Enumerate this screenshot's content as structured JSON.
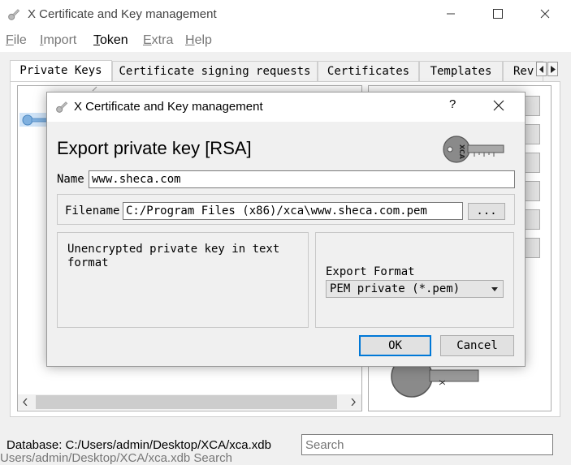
{
  "window": {
    "title": "X Certificate and Key management"
  },
  "menu": {
    "items": [
      {
        "label": "File",
        "underline": "F",
        "rest": "ile"
      },
      {
        "label": "Import",
        "underline": "I",
        "rest": "mport"
      },
      {
        "label": "Token",
        "underline": "T",
        "rest": "oken"
      },
      {
        "label": "Extra",
        "underline": "E",
        "rest": "xtra"
      },
      {
        "label": "Help",
        "underline": "H",
        "rest": "elp"
      }
    ]
  },
  "tabs": [
    {
      "label": "Private Keys",
      "active": true
    },
    {
      "label": "Certificate signing requests",
      "active": false
    },
    {
      "label": "Certificates",
      "active": false
    },
    {
      "label": "Templates",
      "active": false
    },
    {
      "label": "Rev",
      "active": false
    }
  ],
  "statusbar": {
    "database_label": "Database: C:/Users/admin/Desktop/XCA/xca.xdb",
    "search_placeholder": "Search",
    "ghost_text": "Users/admin/Desktop/XCA/xca.xdb   Search"
  },
  "dialog": {
    "title": "X Certificate and Key management",
    "help": "?",
    "heading": "Export private key [RSA]",
    "name_label": "Name",
    "name_value": "www.sheca.com",
    "filename_label": "Filename",
    "filename_value": "C:/Program Files (x86)/xca\\www.sheca.com.pem",
    "browse_label": "...",
    "description": "Unencrypted private key in text format",
    "format_label": "Export Format",
    "format_value": "PEM private (*.pem)",
    "ok_label": "OK",
    "cancel_label": "Cancel"
  },
  "colors": {
    "accent": "#0078d7",
    "key_icon": "#8a8a8a"
  }
}
